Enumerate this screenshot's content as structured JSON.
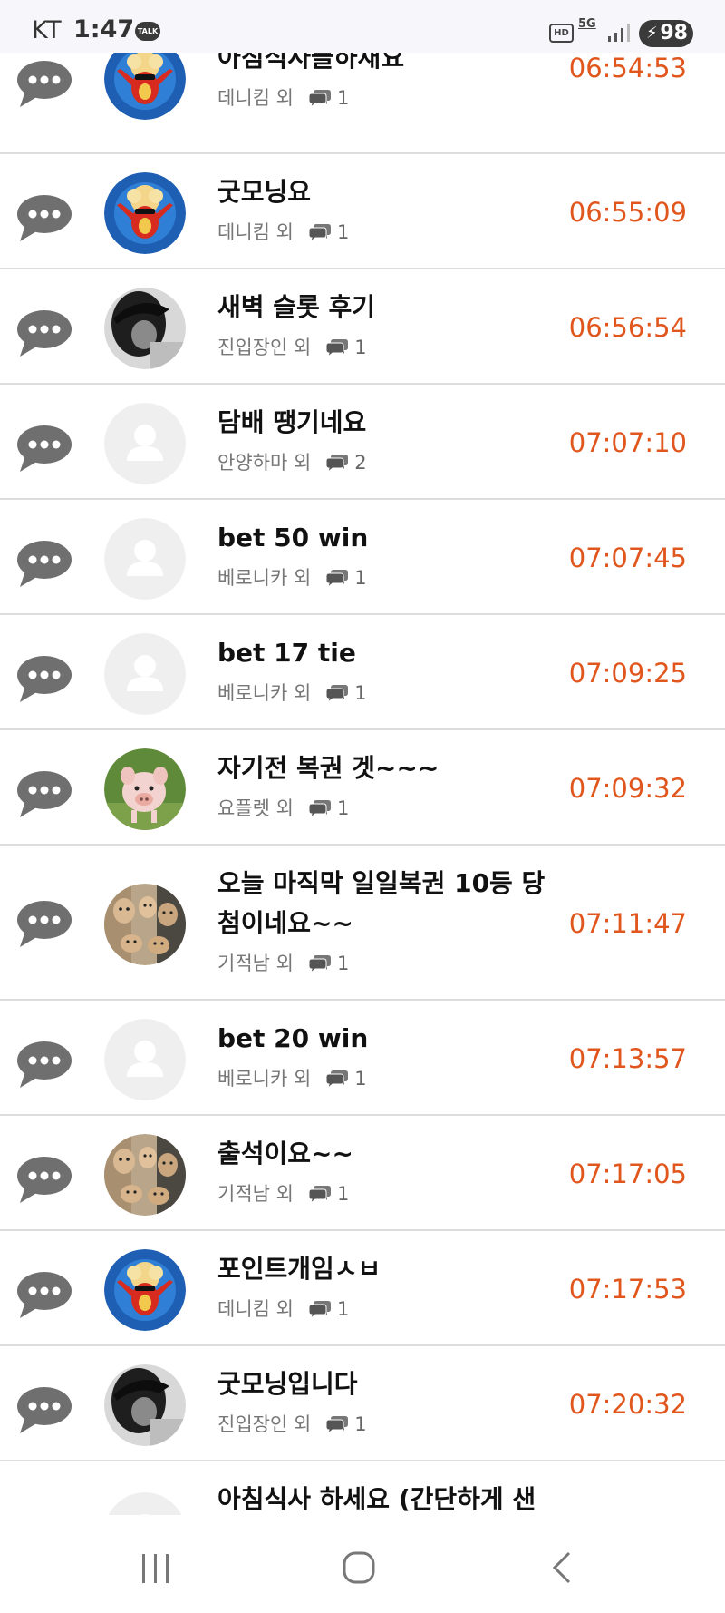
{
  "status_bar": {
    "carrier": "KT",
    "time": "1:47",
    "talk_badge": "TALK",
    "hd_label": "HD",
    "network": "5G",
    "battery": "98"
  },
  "colors": {
    "time_accent": "#e0561d",
    "icon_gray": "#6f6f6f",
    "divider": "#dcdcdc"
  },
  "posts": [
    {
      "title": "아침식사들하새요",
      "author": "데니킴 외",
      "comments": "1",
      "time": "06:54:53",
      "avatar": "bird-avatar"
    },
    {
      "title": "굿모닝요",
      "author": "데니킴 외",
      "comments": "1",
      "time": "06:55:09",
      "avatar": "bird-avatar"
    },
    {
      "title": "새벽 슬롯 후기",
      "author": "진입장인 외",
      "comments": "1",
      "time": "06:56:54",
      "avatar": "bw-photo-avatar"
    },
    {
      "title": "담배 땡기네요",
      "author": "안양하마 외",
      "comments": "2",
      "time": "07:07:10",
      "avatar": "default-avatar"
    },
    {
      "title": "bet 50 win",
      "author": "베로니카 외",
      "comments": "1",
      "time": "07:07:45",
      "avatar": "default-avatar"
    },
    {
      "title": "bet 17 tie",
      "author": "베로니카 외",
      "comments": "1",
      "time": "07:09:25",
      "avatar": "default-avatar"
    },
    {
      "title": "자기전 복권 겟~~~",
      "author": "요플렛 외",
      "comments": "1",
      "time": "07:09:32",
      "avatar": "piglet-avatar"
    },
    {
      "title": "오늘 마직막 일일복권 10등 당첨이네요~~",
      "author": "기적남 외",
      "comments": "1",
      "time": "07:11:47",
      "avatar": "painting-avatar"
    },
    {
      "title": "bet 20 win",
      "author": "베로니카 외",
      "comments": "1",
      "time": "07:13:57",
      "avatar": "default-avatar"
    },
    {
      "title": "출석이요~~",
      "author": "기적남 외",
      "comments": "1",
      "time": "07:17:05",
      "avatar": "painting-avatar"
    },
    {
      "title": "포인트개임ㅅㅂ",
      "author": "데니킴 외",
      "comments": "1",
      "time": "07:17:53",
      "avatar": "bird-avatar"
    },
    {
      "title": "굿모닝입니다",
      "author": "진입장인 외",
      "comments": "1",
      "time": "07:20:32",
      "avatar": "bw-photo-avatar"
    },
    {
      "title": "아침식사 하세요 (간단하게 샌",
      "author": "",
      "comments": "",
      "time": "",
      "avatar": "default-avatar"
    }
  ],
  "nav": {
    "recent_icon": "recent-apps-icon",
    "home_icon": "home-icon",
    "back_icon": "back-icon"
  }
}
